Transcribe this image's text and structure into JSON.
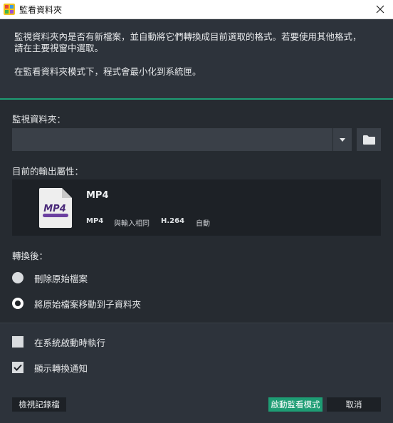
{
  "window": {
    "title": "監看資料夾"
  },
  "info": {
    "line1": "監視資料夾內是否有新檔案，並自動將它們轉換成目前選取的格式。若要使用其他格式，",
    "line2": "請在主要視窗中選取。",
    "line3": "在監看資料夾模式下，程式會最小化到系統匣。"
  },
  "watch_folder": {
    "label": "監視資料夾：",
    "value": "",
    "placeholder": ""
  },
  "output": {
    "label": "目前的輸出屬性：",
    "icon_text": "MP4",
    "format_name": "MP4",
    "details": [
      "MP4",
      "與輸入相同",
      "H.264",
      "自動"
    ]
  },
  "after_conversion": {
    "label": "轉換後：",
    "options": [
      {
        "label": "刪除原始檔案",
        "selected": false
      },
      {
        "label": "將原始檔案移動到子資料夾",
        "selected": true
      }
    ]
  },
  "settings": {
    "run_on_startup": {
      "label": "在系統啟動時執行",
      "checked": false
    },
    "show_notification": {
      "label": "顯示轉換通知",
      "checked": true
    }
  },
  "buttons": {
    "view_log": "檢視記錄檔",
    "start": "啟動監看模式",
    "cancel": "取消"
  },
  "colors": {
    "accent": "#1e9d74",
    "background": "#262b31",
    "panel": "#1d2126"
  }
}
